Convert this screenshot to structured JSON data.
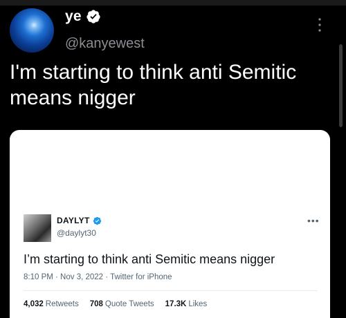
{
  "tweet": {
    "display_name": "ye",
    "handle": "@kanyewest",
    "text": "I'm starting to think anti Semitic means nigger",
    "more_icon": "more-vertical-icon",
    "verified_icon": "verified-badge-icon"
  },
  "quoted_screenshot": {
    "display_name": "DAYLYT",
    "handle": "@daylyt30",
    "text": "I’m starting to think anti Semitic means nigger",
    "timestamp": "8:10 PM · Nov 3, 2022 · Twitter for iPhone",
    "more_icon": "more-horizontal-icon",
    "stats": {
      "retweets_count": "4,032",
      "retweets_label": "Retweets",
      "quotes_count": "708",
      "quotes_label": "Quote Tweets",
      "likes_count": "17.3K",
      "likes_label": "Likes"
    }
  },
  "colors": {
    "background": "#000000",
    "verified": "#1d9bf0",
    "muted_text": "#8b8f94"
  }
}
